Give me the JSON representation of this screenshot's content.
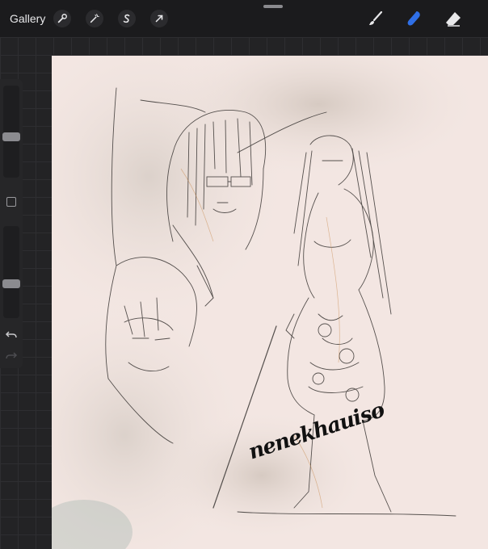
{
  "topbar": {
    "gallery_label": "Gallery",
    "left_tools": [
      "wrench-icon",
      "magic-wand-icon",
      "selection-s-icon",
      "transform-arrow-icon"
    ],
    "right_tools": [
      "brush-icon",
      "smudge-icon",
      "eraser-icon"
    ],
    "active_tool": "smudge-icon"
  },
  "sidebar": {
    "brush_size_level": 0.55,
    "opacity_level": 0.62,
    "undo_icon": "undo-icon",
    "redo_icon": "redo-icon"
  },
  "canvas": {
    "signature": "nenekhauiso",
    "background_color": "#f3e6e2"
  },
  "colors": {
    "accent": "#2f6fe6",
    "toolbar_bg": "#1b1b1d"
  }
}
